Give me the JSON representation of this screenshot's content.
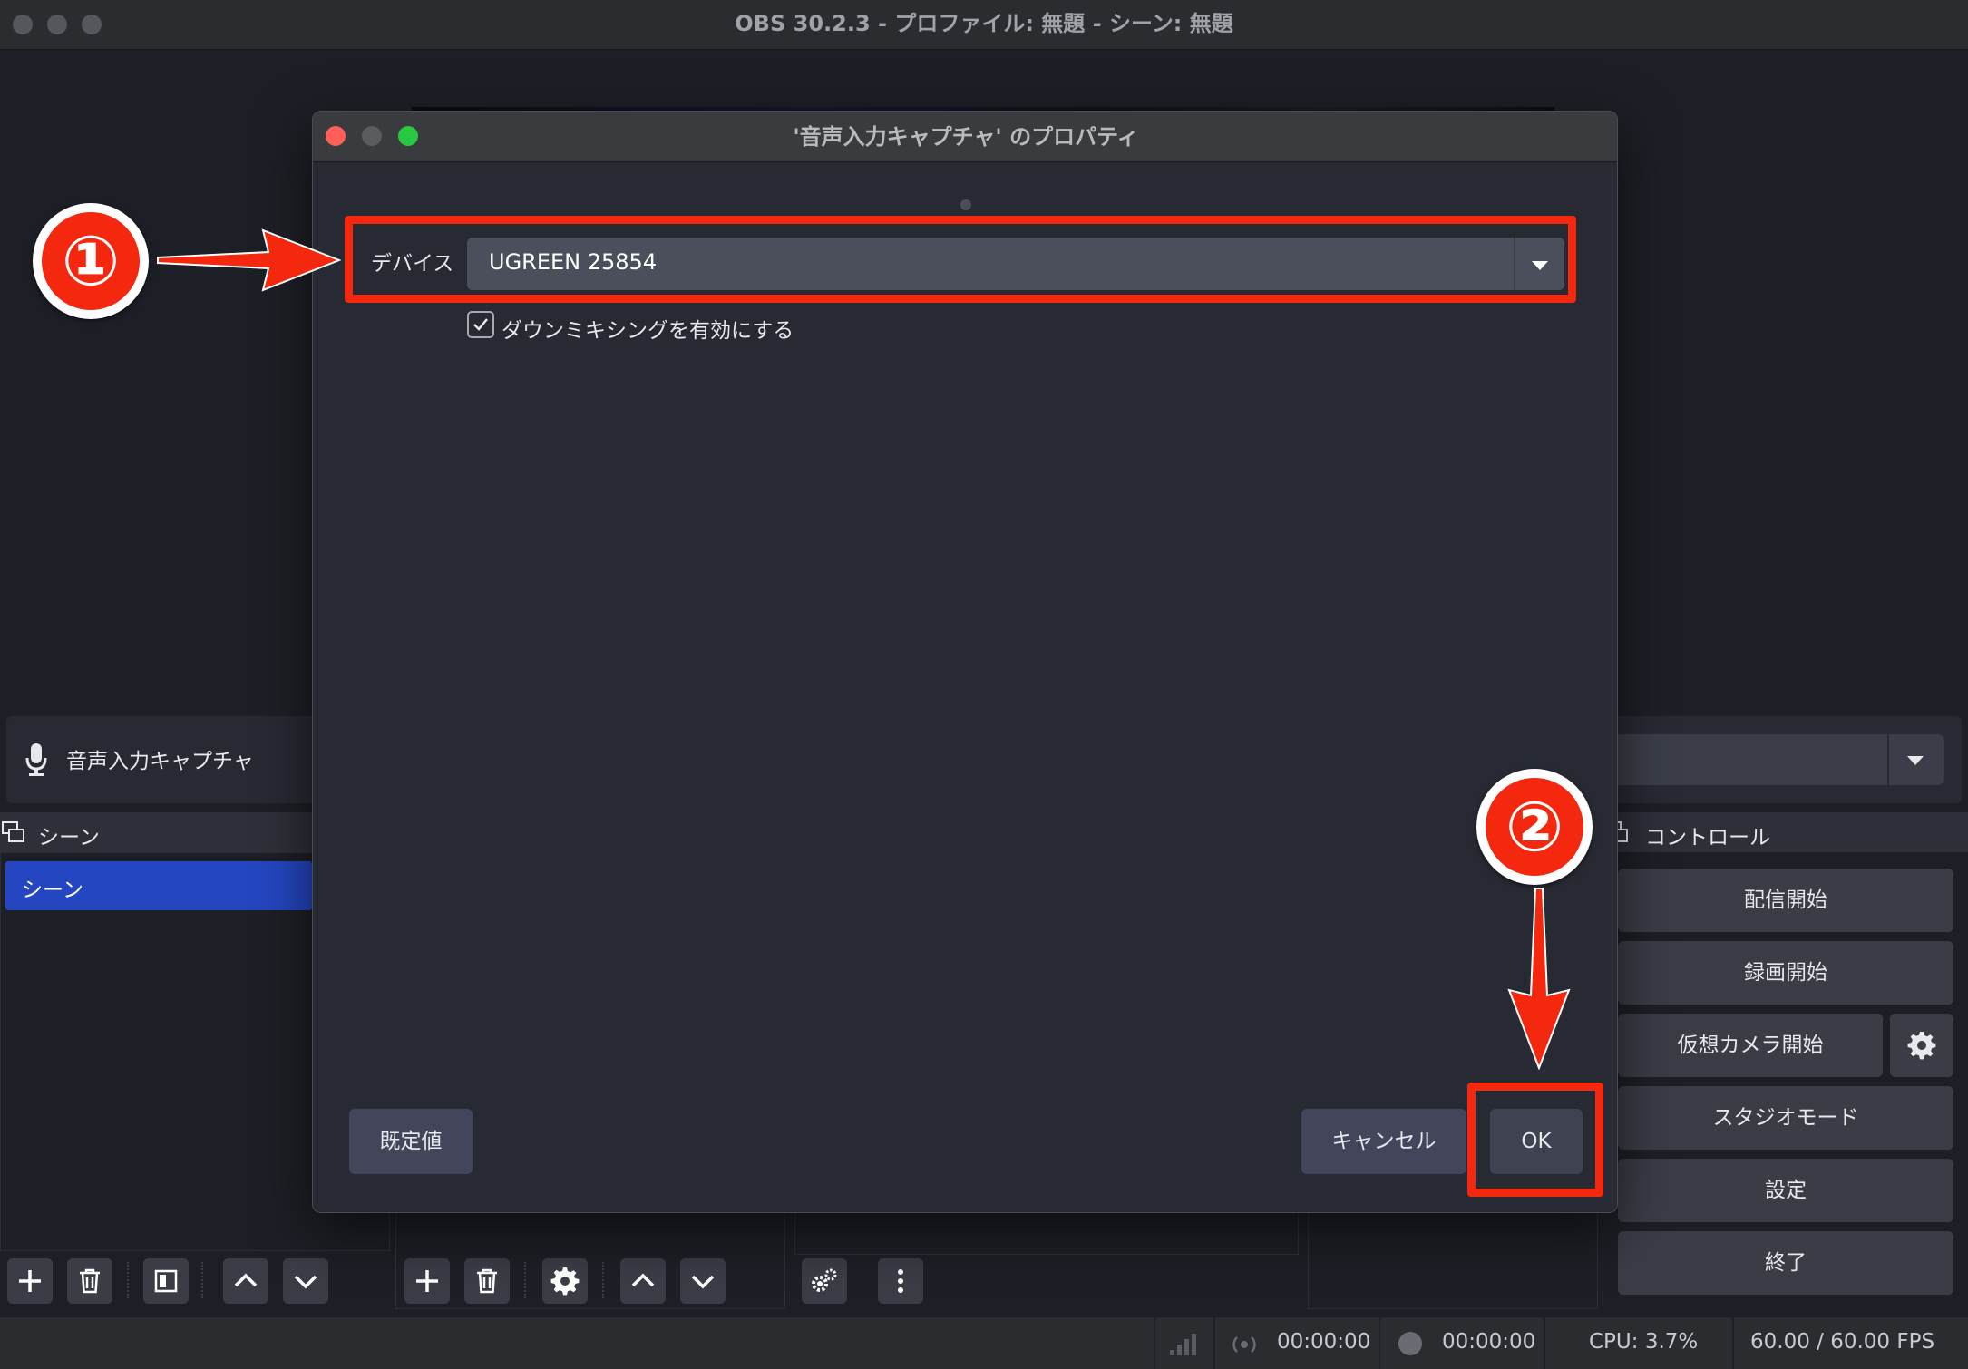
{
  "app": {
    "title": "OBS 30.2.3 - プロファイル: 無題 - シーン: 無題"
  },
  "source_bar": {
    "source_name": "音声入力キャプチャ"
  },
  "scenes_dock": {
    "title": "シーン",
    "items": [
      {
        "label": "シーン",
        "selected": true
      }
    ]
  },
  "controls_dock": {
    "title": "コントロール",
    "start_streaming": "配信開始",
    "start_recording": "録画開始",
    "start_virtual_camera": "仮想カメラ開始",
    "studio_mode": "スタジオモード",
    "settings": "設定",
    "exit": "終了"
  },
  "statusbar": {
    "stream_time": "00:00:00",
    "record_time": "00:00:00",
    "cpu": "CPU: 3.7%",
    "fps": "60.00 / 60.00 FPS"
  },
  "dialog": {
    "title": "'音声入力キャプチャ' のプロパティ",
    "device_label": "デバイス",
    "device_value": "UGREEN 25854",
    "downmix_label": "ダウンミキシングを有効にする",
    "downmix_checked": true,
    "defaults_button": "既定値",
    "cancel_button": "キャンセル",
    "ok_button": "OK"
  },
  "annotations": {
    "marker_1": "①",
    "marker_2": "②",
    "color": "#f4280e"
  },
  "colors": {
    "accent": "#2446c1",
    "background": "#1d1f26"
  }
}
